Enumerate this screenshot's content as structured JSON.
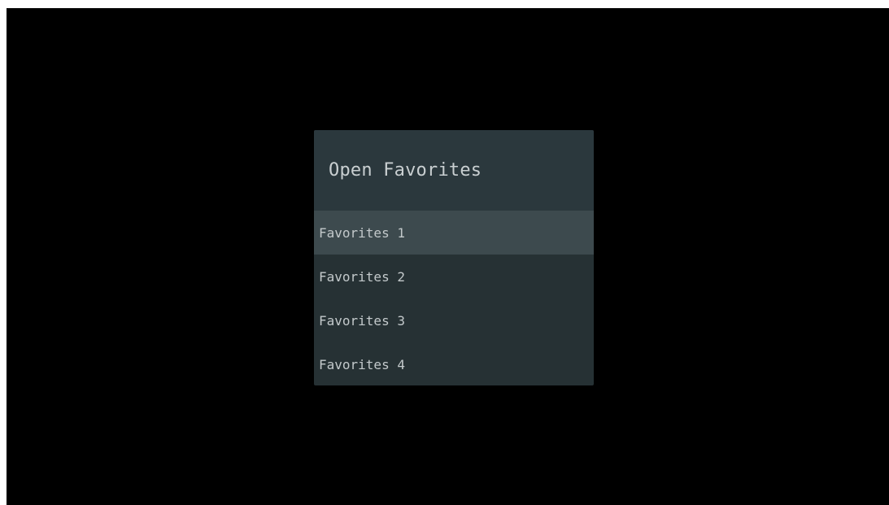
{
  "dialog": {
    "title": "Open Favorites",
    "items": [
      {
        "label": "Favorites 1",
        "selected": true
      },
      {
        "label": "Favorites 2",
        "selected": false
      },
      {
        "label": "Favorites 3",
        "selected": false
      },
      {
        "label": "Favorites 4",
        "selected": false
      }
    ]
  },
  "colors": {
    "background": "#000000",
    "dialog_body": "#263134",
    "dialog_header": "#2b383d",
    "selected_item": "#3d4a4e",
    "text": "#c3c9cb"
  }
}
